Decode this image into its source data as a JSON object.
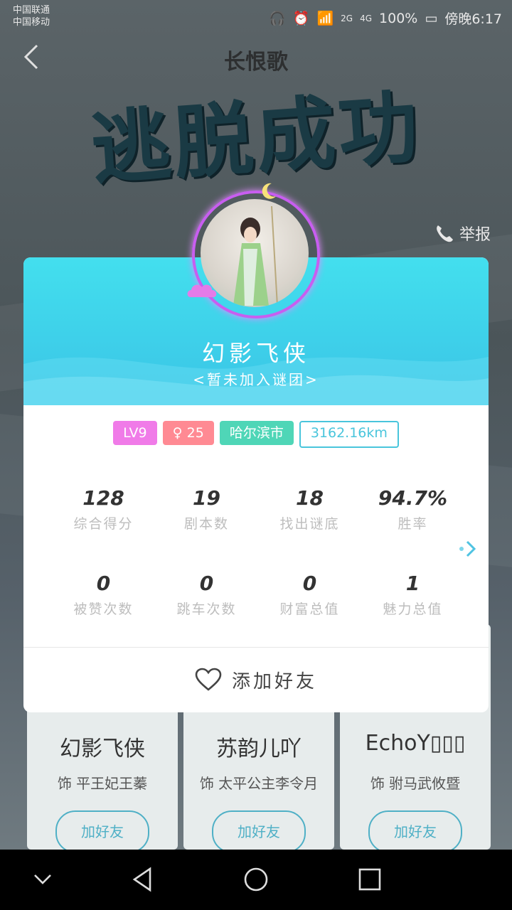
{
  "statusbar": {
    "carrier_1": "中国联通",
    "carrier_2": "中国移动",
    "network_1": "2G",
    "network_2": "4G",
    "battery": "100%",
    "time": "傍晚6:17"
  },
  "header": {
    "song_title": "长恨歌",
    "banner": "逃脱成功",
    "report_label": "举报"
  },
  "profile": {
    "nickname": "幻影飞侠",
    "team": "<暂未加入谜团>",
    "badges": {
      "level": "LV9",
      "age": "25",
      "city": "哈尔滨市",
      "distance": "3162.16km"
    },
    "stats_row1": [
      {
        "value": "128",
        "label": "综合得分"
      },
      {
        "value": "19",
        "label": "剧本数"
      },
      {
        "value": "18",
        "label": "找出谜底"
      },
      {
        "value": "94.7%",
        "label": "胜率"
      }
    ],
    "stats_row2": [
      {
        "value": "0",
        "label": "被赞次数"
      },
      {
        "value": "0",
        "label": "跳车次数"
      },
      {
        "value": "0",
        "label": "财富总值"
      },
      {
        "value": "1",
        "label": "魅力总值"
      }
    ],
    "add_friend_label": "添加好友"
  },
  "players": [
    {
      "name": "幻影飞侠",
      "role": "饰 平王妃王蓁",
      "button": "加好友"
    },
    {
      "name": "苏韵儿吖",
      "role": "饰 太平公主李令月",
      "button": "加好友"
    },
    {
      "name": "EchoY▯▯▯",
      "role": "饰 驸马武攸暨",
      "button": "加好友"
    }
  ]
}
